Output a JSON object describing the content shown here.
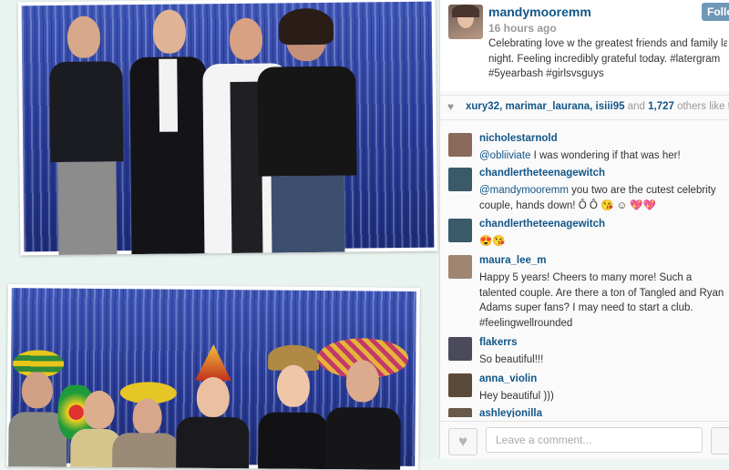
{
  "post": {
    "username": "mandymooremm",
    "time": "16 hours ago",
    "follow_label": "Follo",
    "caption_lines": [
      "Celebrating love w the greatest friends and family las",
      "night. Feeling incredibly grateful today. #latergram",
      "#5yearbash #girlsvsguys"
    ]
  },
  "likes": {
    "users": "xury32, marimar_laurana, isiii95",
    "connector": " and ",
    "count": "1,727",
    "suffix": " others like th"
  },
  "comments": [
    {
      "user": "nicholestarnold",
      "mention": "@obliiviate",
      "text": " I was wondering if that was her!",
      "avatar_color": "#8a6a5a"
    },
    {
      "user": "chandlertheteenagewitch",
      "mention": "@mandymooremm",
      "text": " you two are the cutest celebrity couple, hands down! Ô  Ô  😘 ☺ 💖💖",
      "avatar_color": "#3a5a6a"
    },
    {
      "user": "chandlertheteenagewitch",
      "mention": "",
      "text": "😍😘",
      "avatar_color": "#3a5a6a"
    },
    {
      "user": "maura_lee_m",
      "mention": "",
      "text": "Happy 5 years! Cheers to many more! Such a talented couple. Are there a ton of Tangled and Ryan Adams super fans? I may need to start a club. #feelingwellrounded",
      "avatar_color": "#a08570"
    },
    {
      "user": "flakerrs",
      "mention": "",
      "text": "So beautiful!!!",
      "avatar_color": "#4a4a5a"
    },
    {
      "user": "anna_violin",
      "mention": "",
      "text": "Hey beautiful )))",
      "avatar_color": "#5a4a3a"
    },
    {
      "user": "ashleyjonilla",
      "mention": "",
      "text": "",
      "avatar_color": "#6a5a4a"
    }
  ],
  "composer": {
    "placeholder": "Leave a comment..."
  },
  "colors": {
    "link": "#125688",
    "follow": "#6f97b6",
    "curtain": "#2a3d9a"
  },
  "icons": {
    "likes": "heart-icon",
    "like_button": "heart-icon",
    "more": "ellipsis-icon"
  }
}
